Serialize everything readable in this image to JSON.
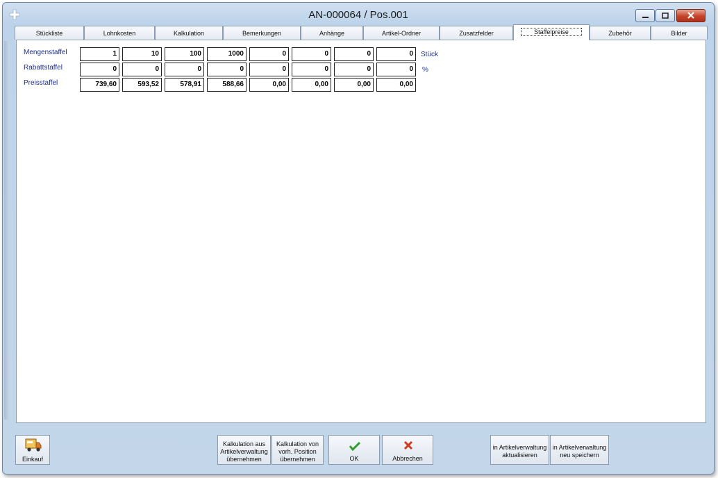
{
  "window": {
    "title": "AN-000064 / Pos.001"
  },
  "tabs": [
    "Stückliste",
    "Lohnkosten",
    "Kalkulation",
    "Bemerkungen",
    "Anhänge",
    "Artikel-Ordner",
    "Zusatzfelder",
    "Staffelpreise",
    "Zubehör",
    "Bilder"
  ],
  "active_tab": "Staffelpreise",
  "staffel": {
    "mengen": {
      "label": "Mengenstaffel",
      "unit": "Stück",
      "values": [
        "1",
        "10",
        "100",
        "1000",
        "0",
        "0",
        "0",
        "0"
      ]
    },
    "rabatt": {
      "label": "Rabattstaffel",
      "unit": "%",
      "values": [
        "0",
        "0",
        "0",
        "0",
        "0",
        "0",
        "0",
        "0"
      ]
    },
    "preis": {
      "label": "Preisstaffel",
      "values": [
        "739,60",
        "593,52",
        "578,91",
        "588,66",
        "0,00",
        "0,00",
        "0,00",
        "0,00"
      ]
    }
  },
  "footer": {
    "einkauf": "Einkauf",
    "kalk_artikel": [
      "Kalkulation aus",
      "Artikelverwaltung",
      "übernehmen"
    ],
    "kalk_position": [
      "Kalkulation von",
      "vorh. Position",
      "übernehmen"
    ],
    "ok": "OK",
    "abbrechen": "Abbrechen",
    "aktualisieren": [
      "in Artikelverwaltung",
      "aktualisieren"
    ],
    "neu_speichern": [
      "in Artikelverwaltung",
      "neu speichern"
    ]
  },
  "colors": {
    "label_blue": "#1b2e8f",
    "ok_green": "#2e9e2e",
    "cancel_red": "#d23a1e"
  }
}
